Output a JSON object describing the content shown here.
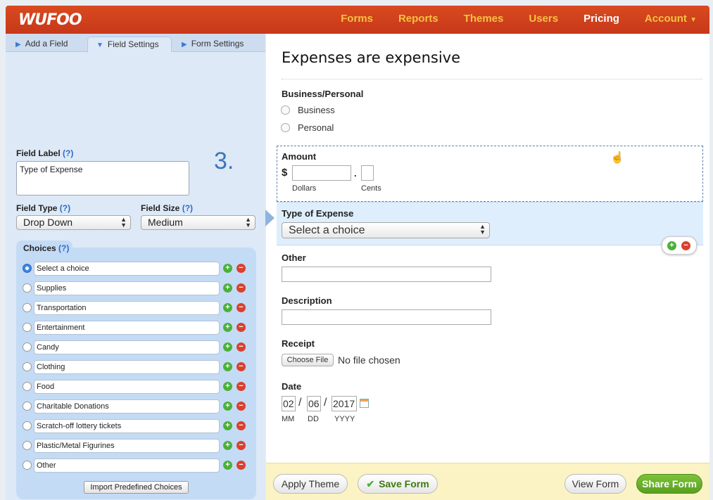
{
  "app": {
    "logo": "WUFOO"
  },
  "nav": {
    "items": [
      {
        "label": "Forms"
      },
      {
        "label": "Reports"
      },
      {
        "label": "Themes"
      },
      {
        "label": "Users"
      },
      {
        "label": "Pricing"
      },
      {
        "label": "Account"
      }
    ]
  },
  "tabs": [
    {
      "label": "Add a Field"
    },
    {
      "label": "Field Settings"
    },
    {
      "label": "Form Settings"
    }
  ],
  "field_settings": {
    "field_label": {
      "label": "Field Label",
      "help": "(?)",
      "value": "Type of Expense"
    },
    "step": "3.",
    "field_type": {
      "label": "Field Type",
      "help": "(?)",
      "value": "Drop Down"
    },
    "field_size": {
      "label": "Field Size",
      "help": "(?)",
      "value": "Medium"
    },
    "choices_title": "Choices",
    "choices_help": "(?)",
    "choices": [
      "Select a choice",
      "Supplies",
      "Transportation",
      "Entertainment",
      "Candy",
      "Clothing",
      "Food",
      "Charitable Donations",
      "Scratch-off lottery tickets",
      "Plastic/Metal Figurines",
      "Other"
    ],
    "selected_choice_index": 0,
    "import_button": "Import Predefined Choices"
  },
  "form": {
    "title": "Expenses are expensive",
    "business_personal": {
      "label": "Business/Personal",
      "options": [
        "Business",
        "Personal"
      ]
    },
    "amount": {
      "label": "Amount",
      "currency": "$",
      "separator": ".",
      "sub_dollars": "Dollars",
      "sub_cents": "Cents"
    },
    "type_of_expense": {
      "label": "Type of Expense",
      "value": "Select a choice"
    },
    "other": {
      "label": "Other"
    },
    "description": {
      "label": "Description"
    },
    "receipt": {
      "label": "Receipt",
      "button": "Choose File",
      "status": "No file chosen"
    },
    "date": {
      "label": "Date",
      "mm": "02",
      "dd": "06",
      "yyyy": "2017",
      "slash": "/",
      "sub_mm": "MM",
      "sub_dd": "DD",
      "sub_yyyy": "YYYY"
    }
  },
  "footer": {
    "apply_theme": "Apply Theme",
    "save_form": "Save Form",
    "view_form": "View Form",
    "share_form": "Share Form"
  },
  "colors": {
    "header": "#c7381a",
    "nav_text": "#f6c142",
    "accent_blue": "#3c76b7",
    "share_green": "#5a9f1f"
  }
}
